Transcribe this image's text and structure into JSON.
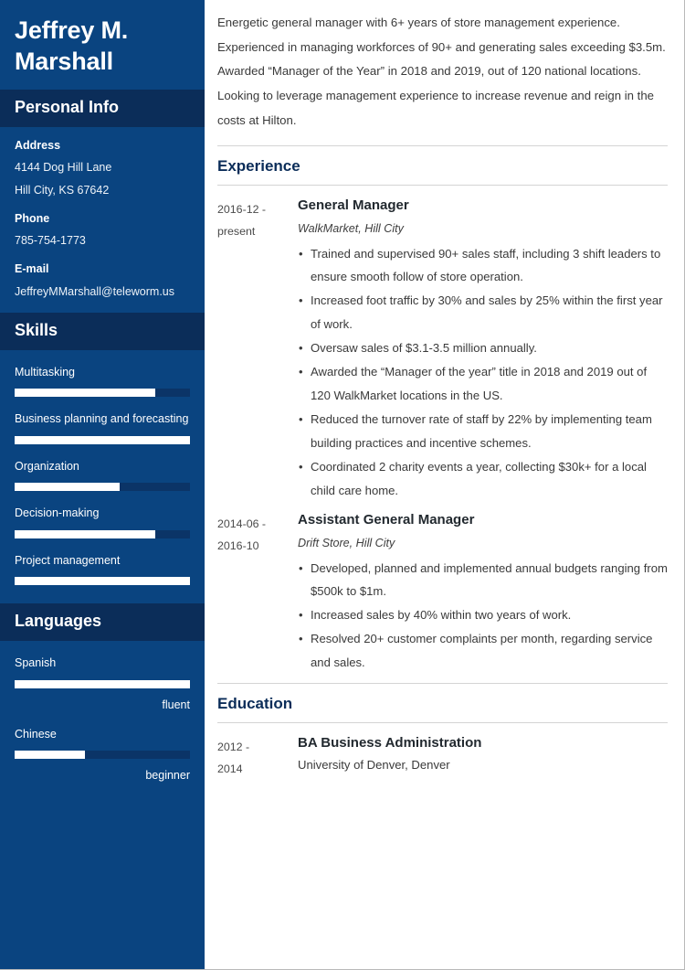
{
  "sidebar": {
    "name_lines": [
      "Jeffrey M.",
      "Marshall"
    ],
    "personal_info": {
      "heading": "Personal Info",
      "address_label": "Address",
      "address_line1": "4144 Dog Hill Lane",
      "address_line2": "Hill City, KS 67642",
      "phone_label": "Phone",
      "phone_value": "785-754-1773",
      "email_label": "E-mail",
      "email_value": "JeffreyMMarshall@teleworm.us"
    },
    "skills": {
      "heading": "Skills",
      "items": [
        {
          "label": "Multitasking",
          "level": 80
        },
        {
          "label": "Business planning and forecasting",
          "level": 100
        },
        {
          "label": "Organization",
          "level": 60
        },
        {
          "label": "Decision-making",
          "level": 80
        },
        {
          "label": "Project management",
          "level": 100
        }
      ]
    },
    "languages": {
      "heading": "Languages",
      "items": [
        {
          "label": "Spanish",
          "level": 100,
          "level_label": "fluent"
        },
        {
          "label": "Chinese",
          "level": 40,
          "level_label": "beginner"
        }
      ]
    }
  },
  "main": {
    "summary": "Energetic general manager with 6+ years of store management experience. Experienced in managing workforces of 90+ and generating sales exceeding $3.5m. Awarded “Manager of the Year” in 2018 and 2019, out of 120 national locations. Looking to leverage management experience to increase revenue and reign in the costs at Hilton.",
    "experience": {
      "heading": "Experience",
      "entries": [
        {
          "date_line1": "2016-12 -",
          "date_line2": "present",
          "title": "General Manager",
          "subtitle": "WalkMarket, Hill City",
          "bullets": [
            "Trained and supervised 90+ sales staff, including 3 shift leaders to ensure smooth follow of store operation.",
            "Increased foot traffic by 30% and sales by 25% within the first year of work.",
            "Oversaw sales of $3.1-3.5 million annually.",
            "Awarded the “Manager of the year” title in 2018 and 2019 out of 120 WalkMarket locations in the US.",
            "Reduced the turnover rate of staff by 22% by implementing team building practices and incentive schemes.",
            "Coordinated 2 charity events a year, collecting $30k+ for a local child care home."
          ]
        },
        {
          "date_line1": "2014-06 -",
          "date_line2": "2016-10",
          "title": "Assistant General Manager",
          "subtitle": "Drift Store, Hill City",
          "bullets": [
            "Developed, planned and implemented annual budgets ranging from $500k to $1m.",
            "Increased sales by 40% within two years of work.",
            "Resolved 20+ customer complaints per month, regarding service and sales."
          ]
        }
      ]
    },
    "education": {
      "heading": "Education",
      "entries": [
        {
          "date_line1": "2012 -",
          "date_line2": "2014",
          "title": "BA Business Administration",
          "subtitle": "University of Denver, Denver"
        }
      ]
    }
  },
  "colors": {
    "sidebar_bg": "#0a4480",
    "sidebar_band": "#0b2d59",
    "bar_track": "#0b3467",
    "bar_fill": "#ffffff",
    "heading": "#0b2d59",
    "body_text": "#3a3a3a"
  }
}
